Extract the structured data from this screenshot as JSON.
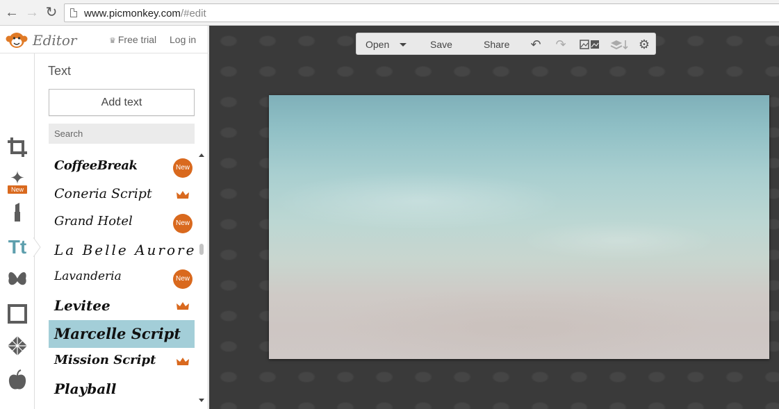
{
  "browser": {
    "url_host": "www.picmonkey.com",
    "url_path": "/#edit"
  },
  "header": {
    "app_label": "Editor",
    "free_trial": "Free trial",
    "login": "Log in"
  },
  "rail": {
    "new_tag": "New",
    "items": [
      "crop-icon",
      "effects-icon",
      "touch-up-icon",
      "text-icon",
      "overlays-icon",
      "frames-icon",
      "textures-icon",
      "themes-icon"
    ]
  },
  "panel": {
    "title": "Text",
    "add_text": "Add text",
    "search_placeholder": "Search"
  },
  "fonts": [
    {
      "name": "CoffeeBreak",
      "badge": "New"
    },
    {
      "name": "Coneria Script",
      "badge": "crown"
    },
    {
      "name": "Grand Hotel",
      "badge": "New"
    },
    {
      "name": "La Belle Aurore",
      "badge": ""
    },
    {
      "name": "Lavanderia",
      "badge": "New"
    },
    {
      "name": "Levitee",
      "badge": "crown"
    },
    {
      "name": "Marcelle Script",
      "badge": "",
      "selected": true
    },
    {
      "name": "Mission Script",
      "badge": "crown"
    },
    {
      "name": "Playball",
      "badge": ""
    }
  ],
  "toolbar": {
    "open": "Open",
    "save": "Save",
    "share": "Share"
  },
  "colors": {
    "accent_orange": "#d9691e",
    "selected_row": "#a3ced8",
    "text_icon_teal": "#5e9fad"
  }
}
